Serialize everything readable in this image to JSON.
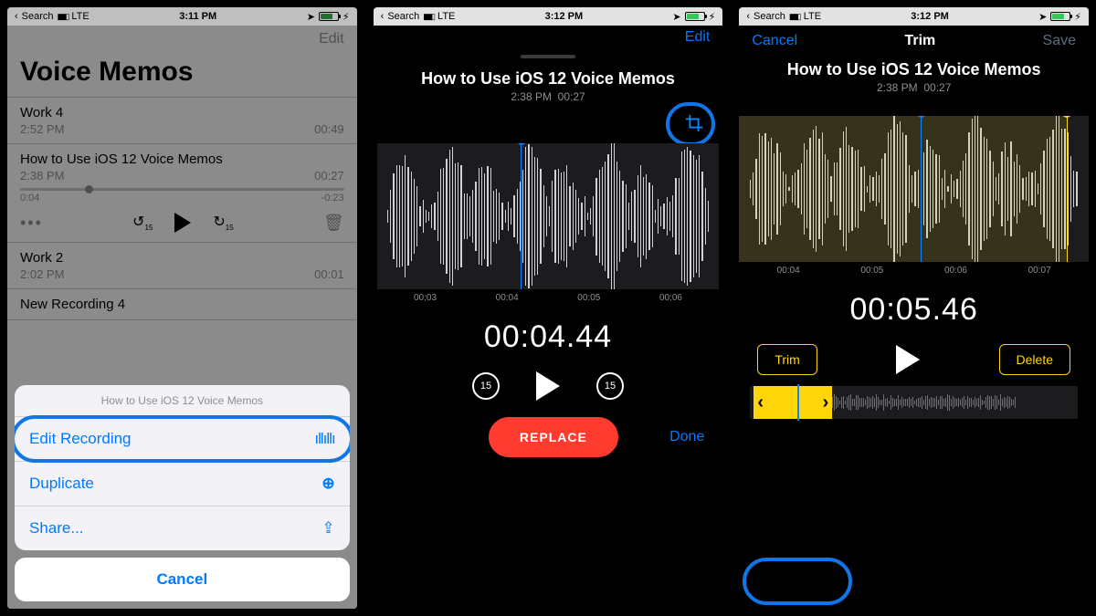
{
  "status": {
    "back_label": "Search",
    "carrier": "LTE",
    "location_icon": "location-arrow",
    "battery_icon": "battery-charging"
  },
  "screen1": {
    "time": "3:11 PM",
    "nav_edit": "Edit",
    "title": "Voice Memos",
    "memos": [
      {
        "name": "Work 4",
        "time": "2:52 PM",
        "dur": "00:49"
      },
      {
        "name": "How to Use iOS 12 Voice Memos",
        "time": "2:38 PM",
        "dur": "00:27"
      },
      {
        "name": "Work 2",
        "time": "2:02 PM",
        "dur": "00:01"
      },
      {
        "name": "New Recording 4",
        "time": "",
        "dur": ""
      }
    ],
    "scrub_left": "0:04",
    "scrub_right": "-0:23",
    "skip_label": "15",
    "sheet": {
      "header": "How to Use iOS 12 Voice Memos",
      "edit": "Edit Recording",
      "dup": "Duplicate",
      "share": "Share...",
      "cancel": "Cancel"
    }
  },
  "screen2": {
    "time": "3:12 PM",
    "nav_edit": "Edit",
    "title": "How to Use iOS 12 Voice Memos",
    "subtitle_time": "2:38 PM",
    "subtitle_dur": "00:27",
    "ticks": [
      "00:03",
      "00:04",
      "00:05",
      "00:06"
    ],
    "timecode": "00:04.44",
    "skip_label": "15",
    "replace": "REPLACE",
    "done": "Done"
  },
  "screen3": {
    "time": "3:12 PM",
    "cancel": "Cancel",
    "nav_title": "Trim",
    "save": "Save",
    "title": "How to Use iOS 12 Voice Memos",
    "subtitle_time": "2:38 PM",
    "subtitle_dur": "00:27",
    "ticks": [
      "00:04",
      "00:05",
      "00:06",
      "00:07"
    ],
    "timecode": "00:05.46",
    "trim_btn": "Trim",
    "delete_btn": "Delete"
  }
}
